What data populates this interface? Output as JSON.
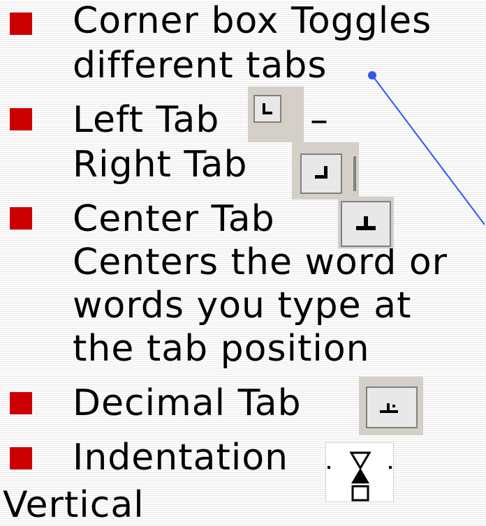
{
  "slide": {
    "lines": [
      {
        "text": "Corner box Toggles",
        "bullet": true
      },
      {
        "text": "different tabs",
        "bullet": false
      },
      {
        "text": "Left Tab",
        "bullet": true
      },
      {
        "text": "–",
        "bullet": false
      },
      {
        "text": "Right Tab",
        "bullet": false
      },
      {
        "text": "Center Tab",
        "bullet": true
      },
      {
        "text": "Centers the word or",
        "bullet": false
      },
      {
        "text": "words you type at",
        "bullet": false
      },
      {
        "text": "the tab position",
        "bullet": false
      },
      {
        "text": "Decimal Tab",
        "bullet": true
      },
      {
        "text": "Indentation",
        "bullet": true
      },
      {
        "text": "Vertical",
        "bullet": false
      }
    ],
    "icons": {
      "left_tab": "left-tab-icon",
      "right_tab": "right-tab-icon",
      "center_tab": "center-tab-icon",
      "decimal_tab": "decimal-tab-icon",
      "indent": "hourglass-indent-icon"
    },
    "colors": {
      "bullet": "#cc0000",
      "connector": "#3355ee",
      "background_lines": "#e6e6e6"
    }
  }
}
